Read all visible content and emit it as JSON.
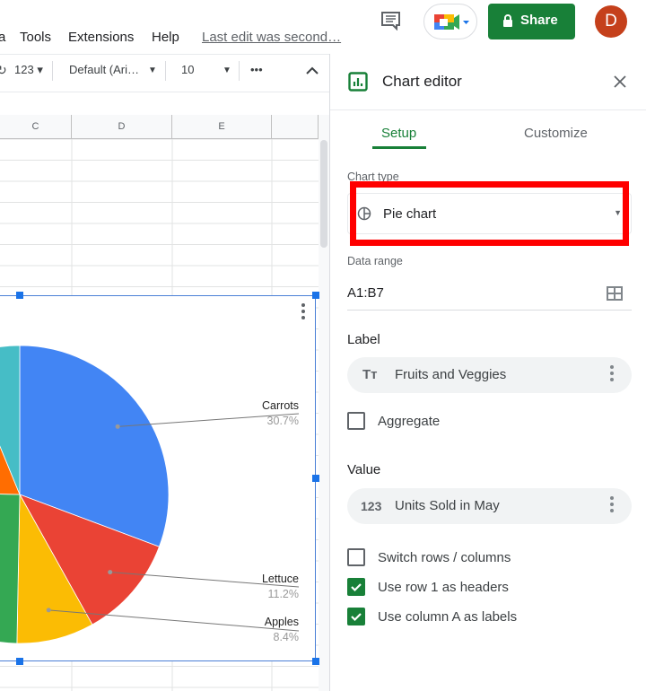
{
  "menu": {
    "items": [
      "a",
      "Tools",
      "Extensions",
      "Help"
    ],
    "last_edit": "Last edit was second…"
  },
  "topbar": {
    "share_label": "Share",
    "avatar_letter": "D",
    "accent": "#188038",
    "avatar_color": "#c5401b"
  },
  "toolbar": {
    "number_format": "123",
    "font": "Default (Ari…",
    "font_size": "10",
    "more": "•••"
  },
  "columns": [
    "C",
    "D",
    "E",
    ""
  ],
  "chart_data": {
    "type": "pie",
    "slices": [
      {
        "name": "Carrots",
        "label": "30.7%",
        "value": 30.7,
        "color": "#4285f4"
      },
      {
        "name": "Lettuce",
        "label": "11.2%",
        "value": 11.2,
        "color": "#ea4335"
      },
      {
        "name": "Apples",
        "label": "8.4%",
        "value": 8.4,
        "color": "#fbbc04"
      },
      {
        "value": 25,
        "color": "#34a853"
      },
      {
        "value": 18.5,
        "color": "#ff6d01"
      },
      {
        "value": 6.2,
        "color": "#46bdc6"
      }
    ]
  },
  "editor": {
    "title": "Chart editor",
    "tabs": [
      {
        "label": "Setup",
        "active": true
      },
      {
        "label": "Customize",
        "active": false
      }
    ],
    "chart_type_label": "Chart type",
    "chart_type": "Pie chart",
    "data_range_label": "Data range",
    "data_range": "A1:B7",
    "label_header": "Label",
    "label_series": "Fruits and Veggies",
    "aggregate": {
      "label": "Aggregate",
      "checked": false
    },
    "value_header": "Value",
    "value_series": "Units Sold in May",
    "options": [
      {
        "label": "Switch rows / columns",
        "checked": false
      },
      {
        "label": "Use row 1 as headers",
        "checked": true
      },
      {
        "label": "Use column A as labels",
        "checked": true
      }
    ]
  }
}
